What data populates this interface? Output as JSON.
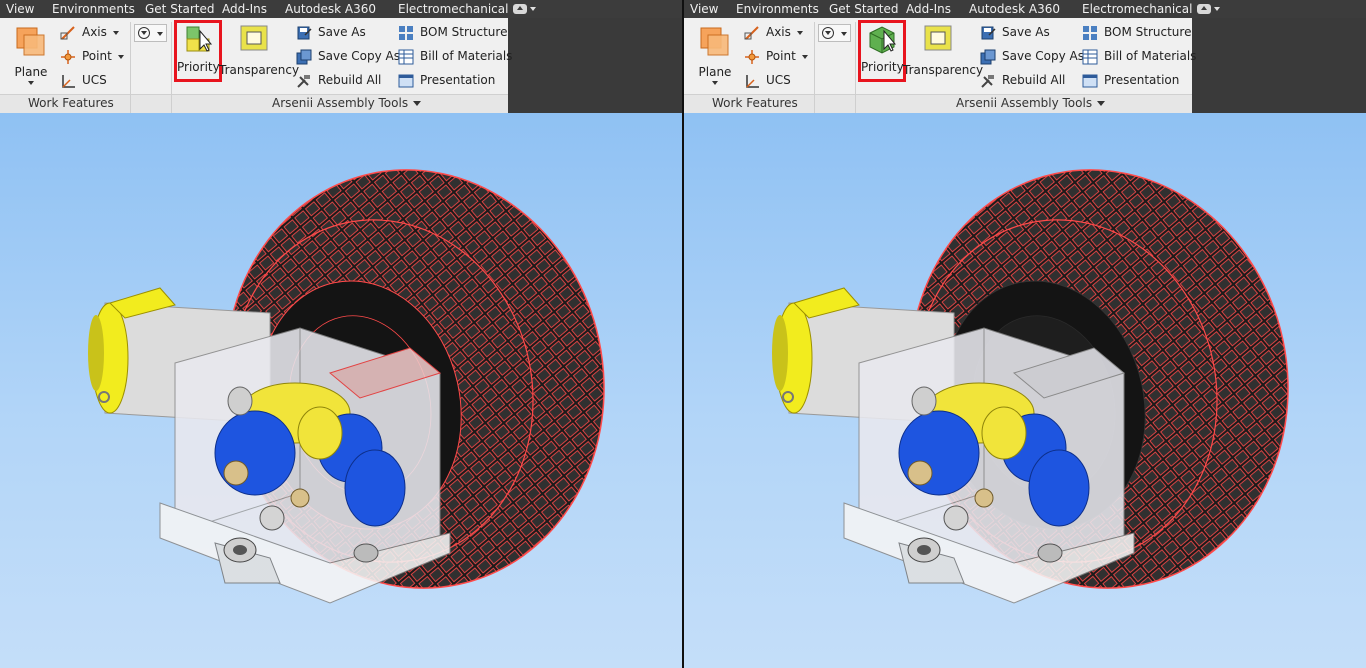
{
  "menu": {
    "tabs": [
      "View",
      "Environments",
      "Get Started",
      "Add-Ins",
      "Autodesk A360",
      "Electromechanical"
    ]
  },
  "ribbon": {
    "work_features": {
      "title": "Work Features",
      "plane": "Plane",
      "axis": "Axis",
      "point": "Point",
      "ucs": "UCS"
    },
    "arsenii": {
      "title": "Arsenii Assembly Tools",
      "priority": "Priority",
      "transparency": "Transparency",
      "save_as": "Save As",
      "save_copy_as": "Save Copy As",
      "rebuild_all": "Rebuild All",
      "bom_structure": "BOM Structure",
      "bill_of_materials": "Bill of Materials",
      "presentation": "Presentation"
    }
  },
  "colors": {
    "highlight_box": "#e8141e",
    "wireframe_highlight": "#ff4a4a",
    "gear_blue": "#1e55e0",
    "gear_yellow": "#f1e43a",
    "motor_yellow": "#f2ec1e",
    "viewport_top": "#8fc1f3",
    "viewport_bottom": "#c4def9"
  },
  "icons": {
    "priority_left": "priority-parts-icon",
    "priority_right": "priority-component-icon",
    "transparency": "transparency-icon"
  }
}
